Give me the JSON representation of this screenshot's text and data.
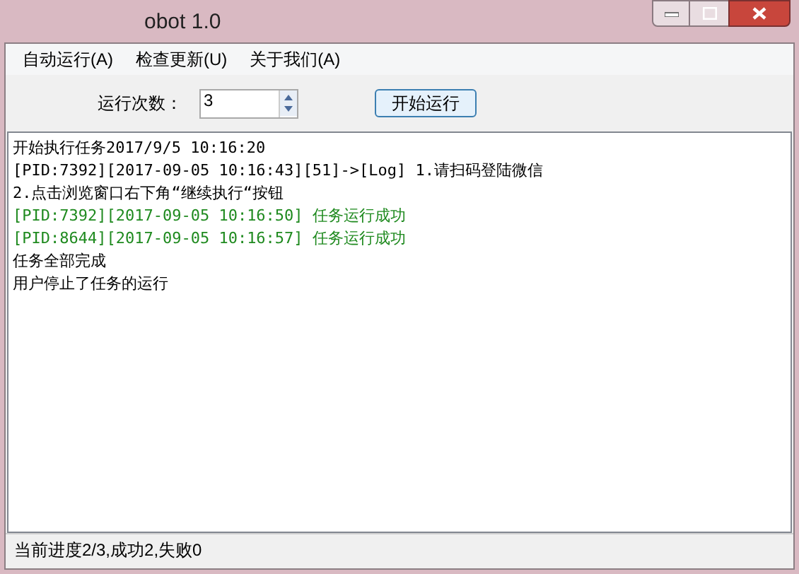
{
  "window": {
    "title": "obot 1.0"
  },
  "menu": [
    {
      "label": "自动运行(A)"
    },
    {
      "label": "检查更新(U)"
    },
    {
      "label": "关于我们(A)"
    }
  ],
  "toolbar": {
    "count_label": "运行次数：",
    "count_value": "3",
    "start_button": "开始运行"
  },
  "log": [
    {
      "kind": "info",
      "text": "开始执行任务2017/9/5 10:16:20"
    },
    {
      "kind": "info",
      "text": "[PID:7392][2017-09-05 10:16:43][51]->[Log] 1.请扫码登陆微信"
    },
    {
      "kind": "info",
      "text": "2.点击浏览窗口右下角“继续执行“按钮"
    },
    {
      "kind": "success",
      "text": "[PID:7392][2017-09-05 10:16:50] 任务运行成功"
    },
    {
      "kind": "success",
      "text": "[PID:8644][2017-09-05 10:16:57] 任务运行成功"
    },
    {
      "kind": "info",
      "text": "任务全部完成"
    },
    {
      "kind": "info",
      "text": "用户停止了任务的运行"
    }
  ],
  "status_bar": "当前进度2/3,成功2,失败0"
}
